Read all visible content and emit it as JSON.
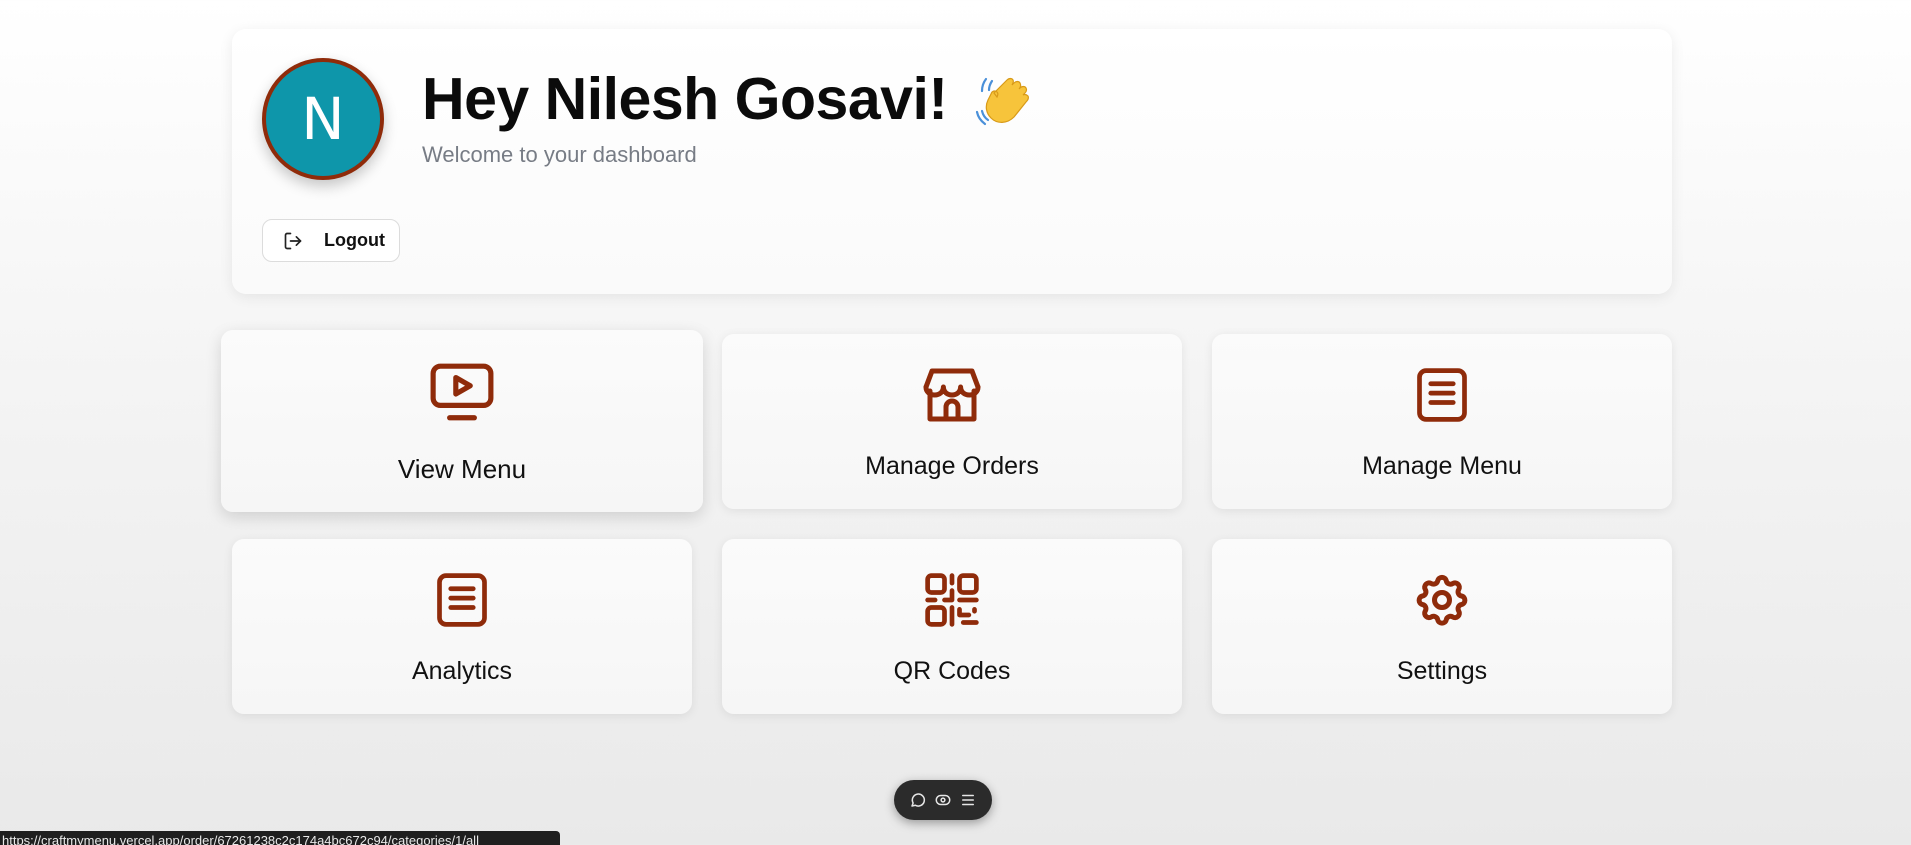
{
  "header": {
    "avatar_initial": "N",
    "greeting": "Hey Nilesh Gosavi!",
    "wave_emoji": "👋",
    "subtitle": "Welcome to your dashboard",
    "logout_label": "Logout"
  },
  "tiles": [
    {
      "label": "View Menu",
      "icon": "monitor-play-icon"
    },
    {
      "label": "Manage Orders",
      "icon": "store-icon"
    },
    {
      "label": "Manage Menu",
      "icon": "document-lines-icon"
    },
    {
      "label": "Analytics",
      "icon": "document-lines-icon"
    },
    {
      "label": "QR Codes",
      "icon": "qr-code-icon"
    },
    {
      "label": "Settings",
      "icon": "gear-icon"
    }
  ],
  "toolbar": {
    "icons": [
      "chat-bubble-icon",
      "eye-toggle-icon",
      "menu-lines-icon"
    ]
  },
  "status_bar": {
    "url": "https://craftmymenu.vercel.app/order/67261238c2c174a4bc672c94/categories/1/all"
  },
  "colors": {
    "accent": "#8f2b0a",
    "avatar_bg": "#0e96aa",
    "subtitle": "#777c85"
  }
}
